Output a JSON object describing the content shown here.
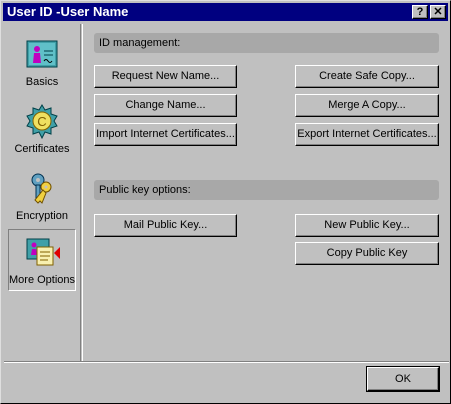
{
  "window": {
    "title": "User ID -User Name",
    "help_button": "?",
    "close_button": "✕"
  },
  "sidebar": {
    "items": [
      {
        "label": "Basics",
        "icon": "id-card-icon"
      },
      {
        "label": "Certificates",
        "icon": "certificate-seal-icon"
      },
      {
        "label": "Encryption",
        "icon": "keys-icon"
      },
      {
        "label": "More Options",
        "icon": "more-options-icon",
        "selected": true
      }
    ]
  },
  "id_management": {
    "header": "ID management:",
    "buttons": {
      "request_new_name": "Request New Name...",
      "create_safe_copy": "Create Safe Copy...",
      "change_name": "Change Name...",
      "merge_a_copy": "Merge A Copy...",
      "import_certificates": "Import Internet Certificates...",
      "export_certificates": "Export Internet Certificates..."
    }
  },
  "public_key": {
    "header": "Public key options:",
    "buttons": {
      "mail_public_key": "Mail Public Key...",
      "new_public_key": "New Public Key...",
      "copy_public_key": "Copy Public Key"
    }
  },
  "footer": {
    "ok_label": "OK"
  },
  "colors": {
    "title_bar": "#000080",
    "face": "#c0c0c0",
    "section_header": "#a8a8a8",
    "arrow": "#e00000"
  }
}
